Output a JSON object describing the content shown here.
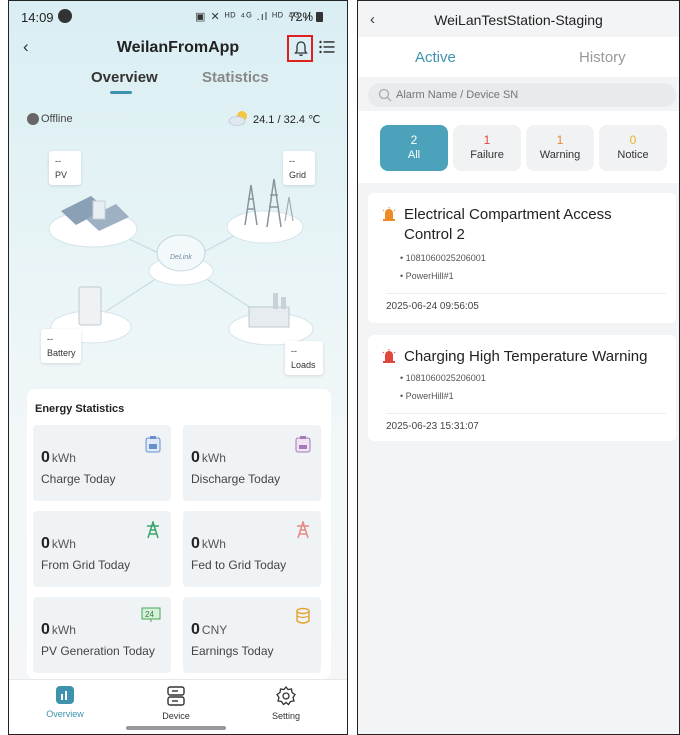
{
  "left": {
    "status": {
      "time": "14:09",
      "battery": "72%"
    },
    "app_title": "WeilanFromApp",
    "tabs": {
      "overview": "Overview",
      "statistics": "Statistics"
    },
    "device_status": "Offline",
    "temperature": "24.1 / 32.4 ℃",
    "diagram": {
      "pv": {
        "value": "--",
        "label": "PV"
      },
      "grid": {
        "value": "--",
        "label": "Grid"
      },
      "battery": {
        "value": "--",
        "label": "Battery"
      },
      "loads": {
        "value": "--",
        "label": "Loads"
      },
      "hub": "DeLink"
    },
    "energy": {
      "title": "Energy Statistics",
      "tiles": [
        {
          "value": "0",
          "unit": "kWh",
          "label": "Charge Today",
          "icon": "battery-charge-icon"
        },
        {
          "value": "0",
          "unit": "kWh",
          "label": "Discharge Today",
          "icon": "battery-discharge-icon"
        },
        {
          "value": "0",
          "unit": "kWh",
          "label": "From Grid Today",
          "icon": "grid-tower-icon"
        },
        {
          "value": "0",
          "unit": "kWh",
          "label": "Fed to Grid Today",
          "icon": "grid-tower-icon"
        },
        {
          "value": "0",
          "unit": "kWh",
          "label": "PV Generation Today",
          "icon": "pv-24-icon"
        },
        {
          "value": "0",
          "unit": "CNY",
          "label": "Earnings Today",
          "icon": "coins-icon"
        }
      ]
    },
    "nav": {
      "overview": "Overview",
      "device": "Device",
      "setting": "Setting"
    },
    "colors": {
      "accent": "#3d93ad",
      "bell_highlight": "#e02020"
    }
  },
  "right": {
    "title": "WeiLanTestStation-Staging",
    "tabs": {
      "active": "Active",
      "history": "History"
    },
    "search_placeholder": "Alarm Name / Device SN",
    "filters": [
      {
        "count": "2",
        "label": "All",
        "color": "#ffffff"
      },
      {
        "count": "1",
        "label": "Failure",
        "color": "#e0473a"
      },
      {
        "count": "1",
        "label": "Warning",
        "color": "#e88a2c"
      },
      {
        "count": "0",
        "label": "Notice",
        "color": "#e6b422"
      }
    ],
    "alarms": [
      {
        "title_line1": "Electrical Compartment Access",
        "title_line2": "Control 2",
        "sn": "• 1081060025206001",
        "station": "• PowerHill#1",
        "time": "2025-06-24 09:56:05",
        "icon_color": "#f08a24"
      },
      {
        "title_line1": "Charging High Temperature Warning",
        "title_line2": "",
        "sn": "• 1081060025206001",
        "station": "• PowerHill#1",
        "time": "2025-06-23 15:31:07",
        "icon_color": "#e0473a"
      }
    ]
  }
}
